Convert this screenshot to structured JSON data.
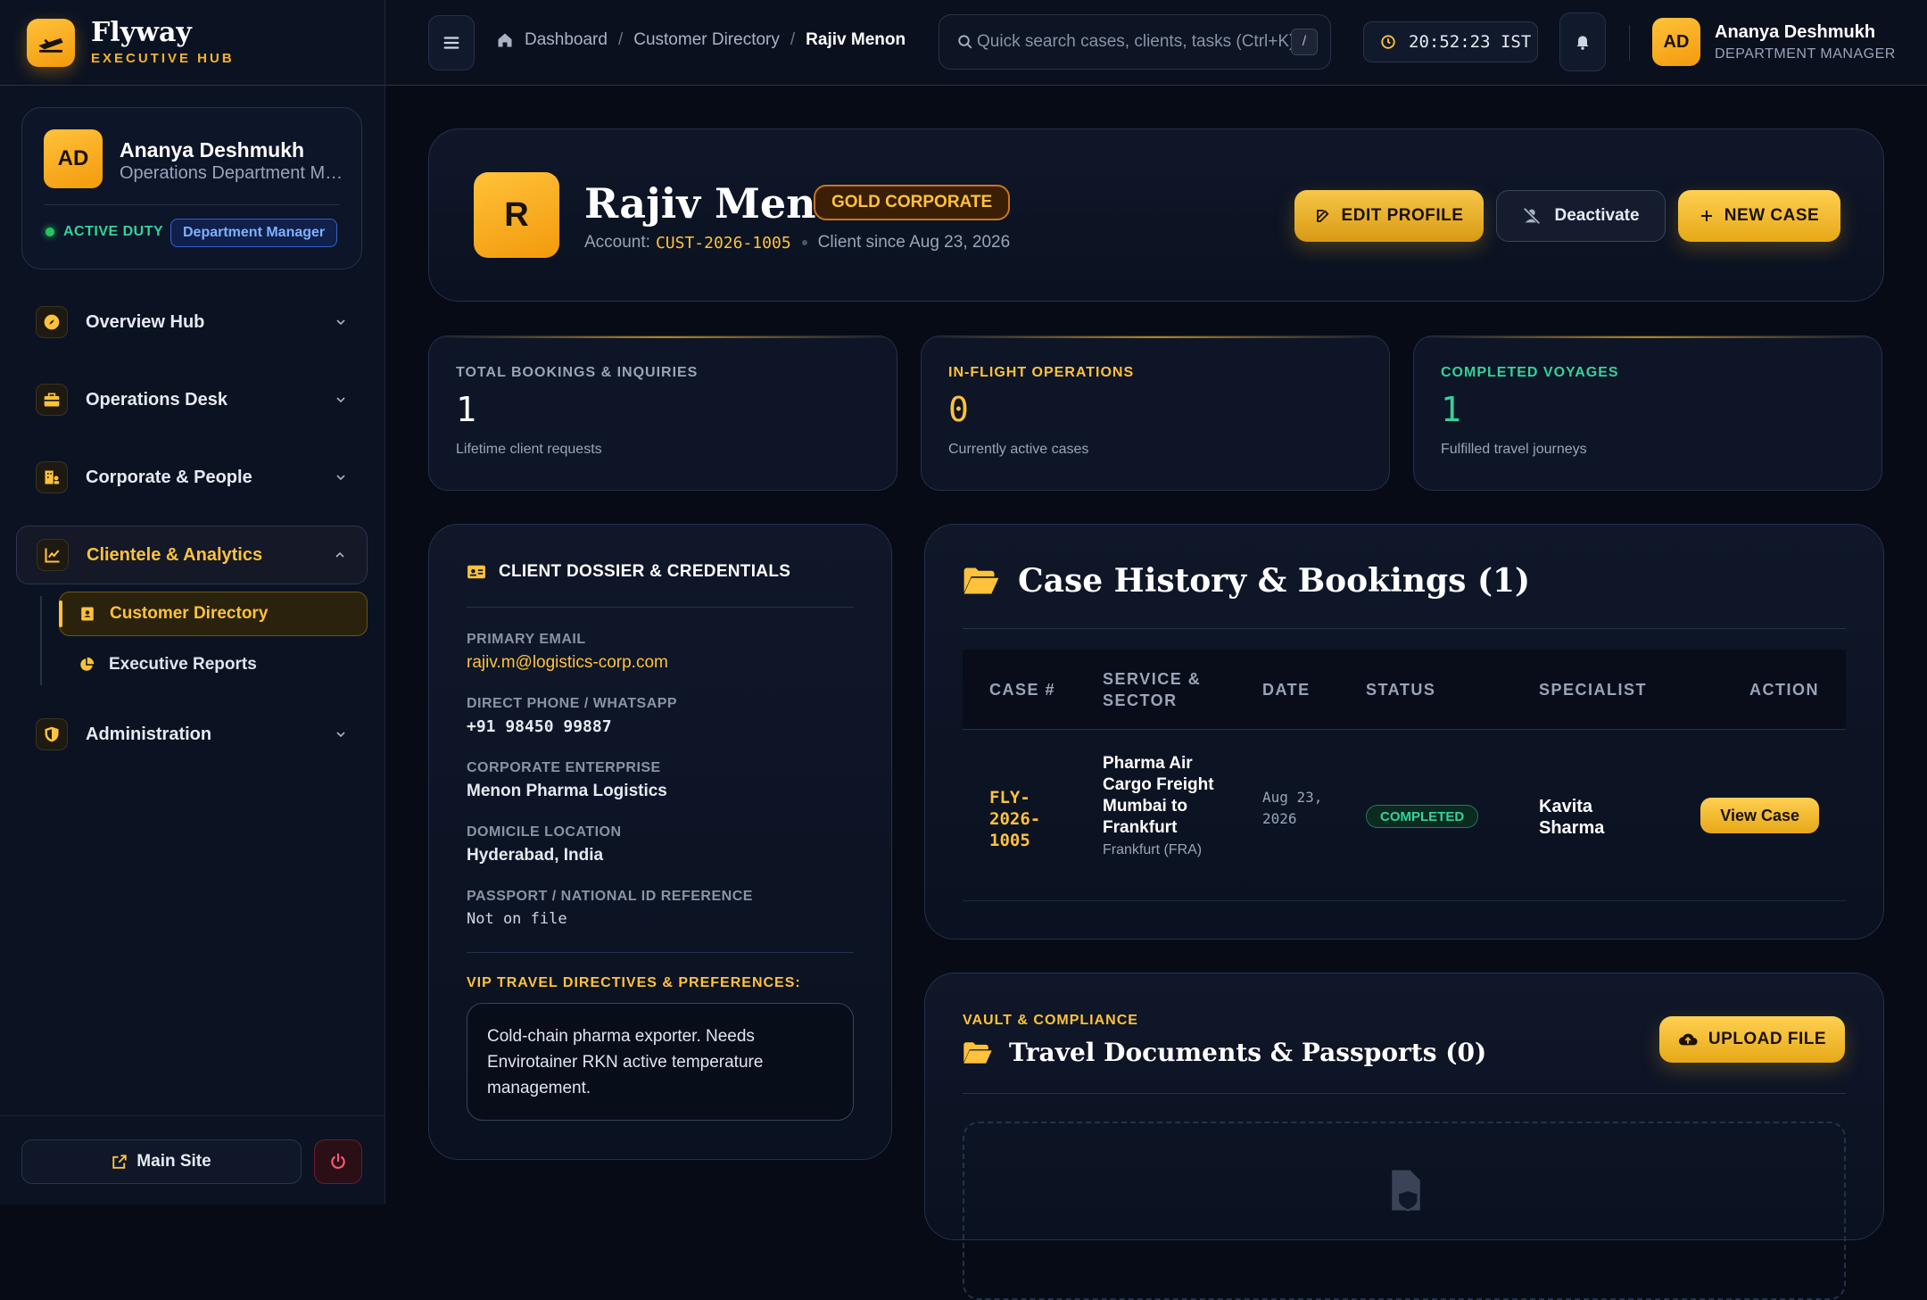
{
  "brand": {
    "name": "Flyway",
    "tagline": "EXECUTIVE HUB"
  },
  "user": {
    "initials": "AD",
    "name": "Ananya Deshmukh",
    "role_full": "Operations Department Manager",
    "duty": "ACTIVE DUTY",
    "badge": "Department Manager",
    "role_top": "DEPARTMENT MANAGER"
  },
  "sidebar": {
    "items": [
      {
        "label": "Overview Hub",
        "icon": "compass-icon"
      },
      {
        "label": "Operations Desk",
        "icon": "briefcase-icon"
      },
      {
        "label": "Corporate & People",
        "icon": "building-people-icon"
      },
      {
        "label": "Clientele & Analytics",
        "icon": "chart-line-icon",
        "expanded": true
      },
      {
        "label": "Administration",
        "icon": "shield-icon"
      }
    ],
    "subitems": [
      {
        "label": "Customer Directory",
        "icon": "contact-card-icon",
        "active": true
      },
      {
        "label": "Executive Reports",
        "icon": "pie-chart-icon"
      }
    ],
    "footer": {
      "main_site": "Main Site"
    }
  },
  "topbar": {
    "breadcrumb": [
      "Dashboard",
      "Customer Directory",
      "Rajiv Menon"
    ],
    "search_placeholder": "Quick search cases, clients, tasks (Ctrl+K)...",
    "search_kbd": "/",
    "clock": "20:52:23 IST"
  },
  "client": {
    "initial": "R",
    "name": "Rajiv Menon",
    "tier": "GOLD CORPORATE",
    "account_label": "Account:",
    "account_id": "CUST-2026-1005",
    "since": "Client since Aug 23, 2026",
    "actions": {
      "edit": "EDIT PROFILE",
      "deactivate": "Deactivate",
      "new_case": "NEW CASE"
    }
  },
  "stats": [
    {
      "label": "TOTAL BOOKINGS & INQUIRIES",
      "value": "1",
      "sub": "Lifetime client requests",
      "color": "#9aa4b8"
    },
    {
      "label": "IN-FLIGHT OPERATIONS",
      "value": "0",
      "sub": "Currently active cases",
      "color": "#ffc23a"
    },
    {
      "label": "COMPLETED VOYAGES",
      "value": "1",
      "sub": "Fulfilled travel journeys",
      "color": "#34d399"
    }
  ],
  "dossier": {
    "title": "CLIENT DOSSIER & CREDENTIALS",
    "fields": [
      {
        "label": "PRIMARY EMAIL",
        "value": "rajiv.m@logistics-corp.com"
      },
      {
        "label": "DIRECT PHONE / WHATSAPP",
        "value": "+91 98450 99887"
      },
      {
        "label": "CORPORATE ENTERPRISE",
        "value": "Menon Pharma Logistics"
      },
      {
        "label": "DOMICILE LOCATION",
        "value": "Hyderabad, India"
      },
      {
        "label": "PASSPORT / NATIONAL ID REFERENCE",
        "value": "Not on file"
      }
    ],
    "vip_label": "VIP TRAVEL DIRECTIVES & PREFERENCES:",
    "vip_text": "Cold-chain pharma exporter. Needs Envirotainer RKN active temperature management."
  },
  "history": {
    "title": "Case History & Bookings (1)",
    "columns": [
      "CASE #",
      "SERVICE & SECTOR",
      "DATE",
      "STATUS",
      "SPECIALIST",
      "ACTION"
    ],
    "rows": [
      {
        "case": "FLY-2026-1005",
        "service": "Pharma Air Cargo Freight Mumbai to Frankfurt",
        "sector": "Frankfurt (FRA)",
        "date": "Aug 23, 2026",
        "status": "COMPLETED",
        "specialist": "Kavita Sharma",
        "action": "View Case"
      }
    ]
  },
  "vault": {
    "eyebrow": "VAULT & COMPLIANCE",
    "title": "Travel Documents & Passports (0)",
    "upload": "UPLOAD FILE"
  },
  "colors": {
    "accent": "#ffc23a",
    "success": "#34d399",
    "bg": "#070b16"
  }
}
